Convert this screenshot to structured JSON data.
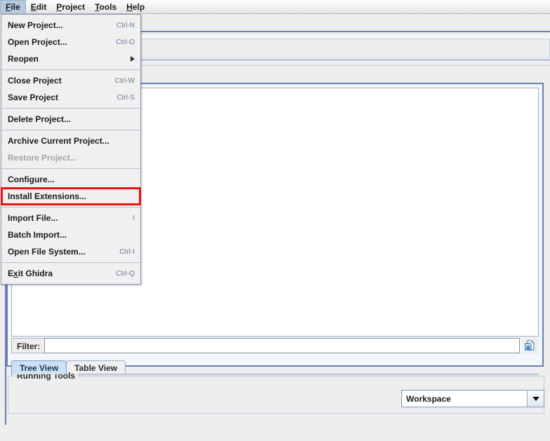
{
  "menubar": {
    "items": [
      {
        "label": "File",
        "mnemonic": "F",
        "selected": true
      },
      {
        "label": "Edit",
        "mnemonic": "E",
        "selected": false
      },
      {
        "label": "Project",
        "mnemonic": "P",
        "selected": false
      },
      {
        "label": "Tools",
        "mnemonic": "T",
        "selected": false
      },
      {
        "label": "Help",
        "mnemonic": "H",
        "selected": false
      }
    ]
  },
  "file_menu": {
    "open": true,
    "items": [
      {
        "type": "item",
        "label": "New Project...",
        "accel": "Ctrl-N",
        "disabled": false,
        "submenu": false,
        "highlighted": false
      },
      {
        "type": "item",
        "label": "Open Project...",
        "accel": "Ctrl-O",
        "disabled": false,
        "submenu": false,
        "highlighted": false
      },
      {
        "type": "item",
        "label": "Reopen",
        "accel": "",
        "disabled": false,
        "submenu": true,
        "highlighted": false
      },
      {
        "type": "separator"
      },
      {
        "type": "item",
        "label": "Close Project",
        "accel": "Ctrl-W",
        "disabled": false,
        "submenu": false,
        "highlighted": false
      },
      {
        "type": "item",
        "label": "Save Project",
        "accel": "Ctrl-S",
        "disabled": false,
        "submenu": false,
        "highlighted": false
      },
      {
        "type": "separator"
      },
      {
        "type": "item",
        "label": "Delete Project...",
        "accel": "",
        "disabled": false,
        "submenu": false,
        "highlighted": false
      },
      {
        "type": "separator"
      },
      {
        "type": "item",
        "label": "Archive Current Project...",
        "accel": "",
        "disabled": false,
        "submenu": false,
        "highlighted": false
      },
      {
        "type": "item",
        "label": "Restore Project...",
        "accel": "",
        "disabled": true,
        "submenu": false,
        "highlighted": false
      },
      {
        "type": "separator"
      },
      {
        "type": "item",
        "label": "Configure...",
        "accel": "",
        "disabled": false,
        "submenu": false,
        "highlighted": false
      },
      {
        "type": "item",
        "label": "Install Extensions...",
        "accel": "",
        "disabled": false,
        "submenu": false,
        "highlighted": true
      },
      {
        "type": "separator"
      },
      {
        "type": "item",
        "label": "Import File...",
        "accel": "I",
        "disabled": false,
        "submenu": false,
        "highlighted": false
      },
      {
        "type": "item",
        "label": "Batch Import...",
        "accel": "",
        "disabled": false,
        "submenu": false,
        "highlighted": false
      },
      {
        "type": "item",
        "label": "Open File System...",
        "accel": "Ctrl-I",
        "disabled": false,
        "submenu": false,
        "highlighted": false
      },
      {
        "type": "separator"
      },
      {
        "type": "item",
        "label": "Exit Ghidra",
        "accel": "Ctrl-Q",
        "disabled": false,
        "submenu": false,
        "highlighted": false
      }
    ]
  },
  "annotation": {
    "target_label": "Install Extensions...",
    "color": "#ee1111"
  },
  "tree_panel": {
    "filter_label": "Filter:",
    "filter_value": "",
    "filter_placeholder": "",
    "filter_icon": "filter-document-icon",
    "tabs": [
      {
        "label": "Tree View",
        "active": true
      },
      {
        "label": "Table View",
        "active": false
      }
    ]
  },
  "running_tools": {
    "title": "Running Tools",
    "workspace": {
      "value": "Workspace",
      "icon": "chevron-down-icon"
    }
  },
  "colors": {
    "background": "#eeeeee",
    "panel_border": "#6a7fb0",
    "menu_selected": "#b6c8dd",
    "tab_active": "#cfe0f2",
    "accel_text": "#6b7a92",
    "annotation_red": "#ee1111"
  }
}
